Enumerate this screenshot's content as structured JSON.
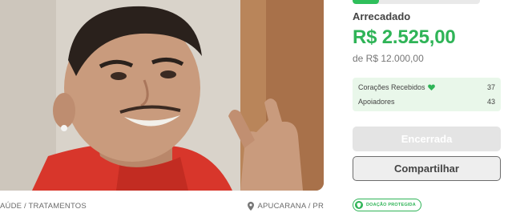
{
  "campaign": {
    "photo_alt": "campaign-photo",
    "category": "AÚDE / TRATAMENTOS",
    "location": "APUCARANA / PR"
  },
  "donation": {
    "progress_fraction": 0.21,
    "raised_label": "Arrecadado",
    "raised_amount": "R$ 2.525,00",
    "goal_text": "de R$ 12.000,00",
    "stats": [
      {
        "label": "Corações Recebidos",
        "value": "37",
        "icon": "heart-icon"
      },
      {
        "label": "Apoiadores",
        "value": "43"
      }
    ],
    "closed_button": "Encerrada",
    "share_button": "Compartilhar",
    "protected_badge": "DOAÇÃO PROTEGIDA"
  },
  "colors": {
    "accent_green": "#2fb457",
    "stats_bg": "#e9f7ea",
    "disabled_button": "#e4e4e4"
  }
}
